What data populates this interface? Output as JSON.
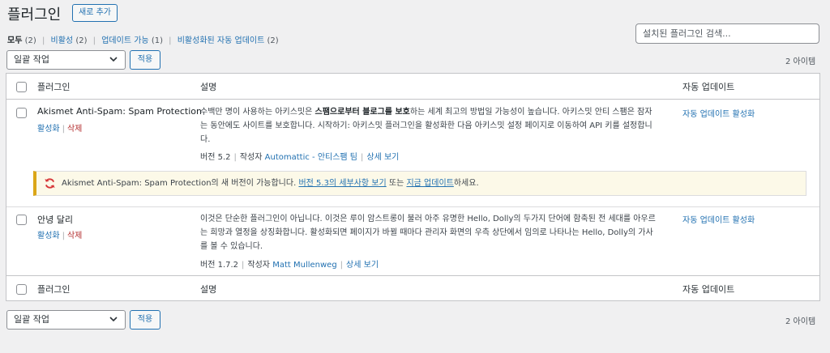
{
  "header": {
    "title": "플러그인",
    "add_new": "새로 추가"
  },
  "filters": {
    "all": "모두",
    "all_count": "(2)",
    "inactive": "비활성",
    "inactive_count": "(2)",
    "update": "업데이트 가능",
    "update_count": "(1)",
    "auto_disabled": "비활성화된 자동 업데이트",
    "auto_disabled_count": "(2)",
    "separator": "|"
  },
  "search": {
    "placeholder": "설치된 플러그인 검색..."
  },
  "bulk": {
    "top_label": "일괄 작업",
    "bottom_label": "일괄 작업",
    "apply": "적용",
    "items_count": "2 아이템"
  },
  "table": {
    "columns": {
      "plugin": "플러그인",
      "description": "설명",
      "auto_update": "자동 업데이트"
    },
    "rows": [
      {
        "name": "Akismet Anti-Spam: Spam Protection",
        "activate": "활성화",
        "delete": "삭제",
        "desc_part1": "수백만 명이 사용하는 아키스밋은 ",
        "desc_bold": "스팸으로부터 블로그를 보호",
        "desc_part2": "하는 세계 최고의 방법일 가능성이 높습니다. 아키스밋 안티 스팸은 잠자는 동안에도 사이트를 보호합니다. 시작하기: 아키스밋 플러그인을 활성화한 다음 아키스밋 설정 페이지로 이동하여 API 키를 설정합니다.",
        "version": "버전 5.2",
        "author_label": "작성자",
        "author": "Automattic - 안티스팸 팀",
        "details": "상세 보기",
        "auto_update": "자동 업데이트 활성화"
      },
      {
        "name": "안녕 달리",
        "activate": "활성화",
        "delete": "삭제",
        "desc": "이것은 단순한 플러그인이 아닙니다. 이것은 루이 암스트롱이 불러 아주 유명한 Hello, Dolly의 두가지 단어에 함축된 전 세대를 아우르는 희망과 열정을 상징화합니다. 활성화되면 페이지가 바뀔 때마다 관리자 화면의 우측 상단에서 임의로 나타나는 Hello, Dolly의 가사를 볼 수 있습니다.",
        "version": "버전 1.7.2",
        "author_label": "작성자",
        "author": "Matt Mullenweg",
        "details": "상세 보기",
        "auto_update": "자동 업데이트 활성화"
      }
    ],
    "notice": {
      "text1": "Akismet Anti-Spam: Spam Protection의 새 버전이 가능합니다. ",
      "link1": "버전 5.3의 세부사항 보기",
      "text2": " 또는 ",
      "link2": "지금 업데이트",
      "text3": "하세요."
    }
  },
  "colors": {
    "accent": "#2271b1",
    "delete": "#b32d2e",
    "notice_border": "#dba617",
    "update_icon": "#d63638"
  }
}
